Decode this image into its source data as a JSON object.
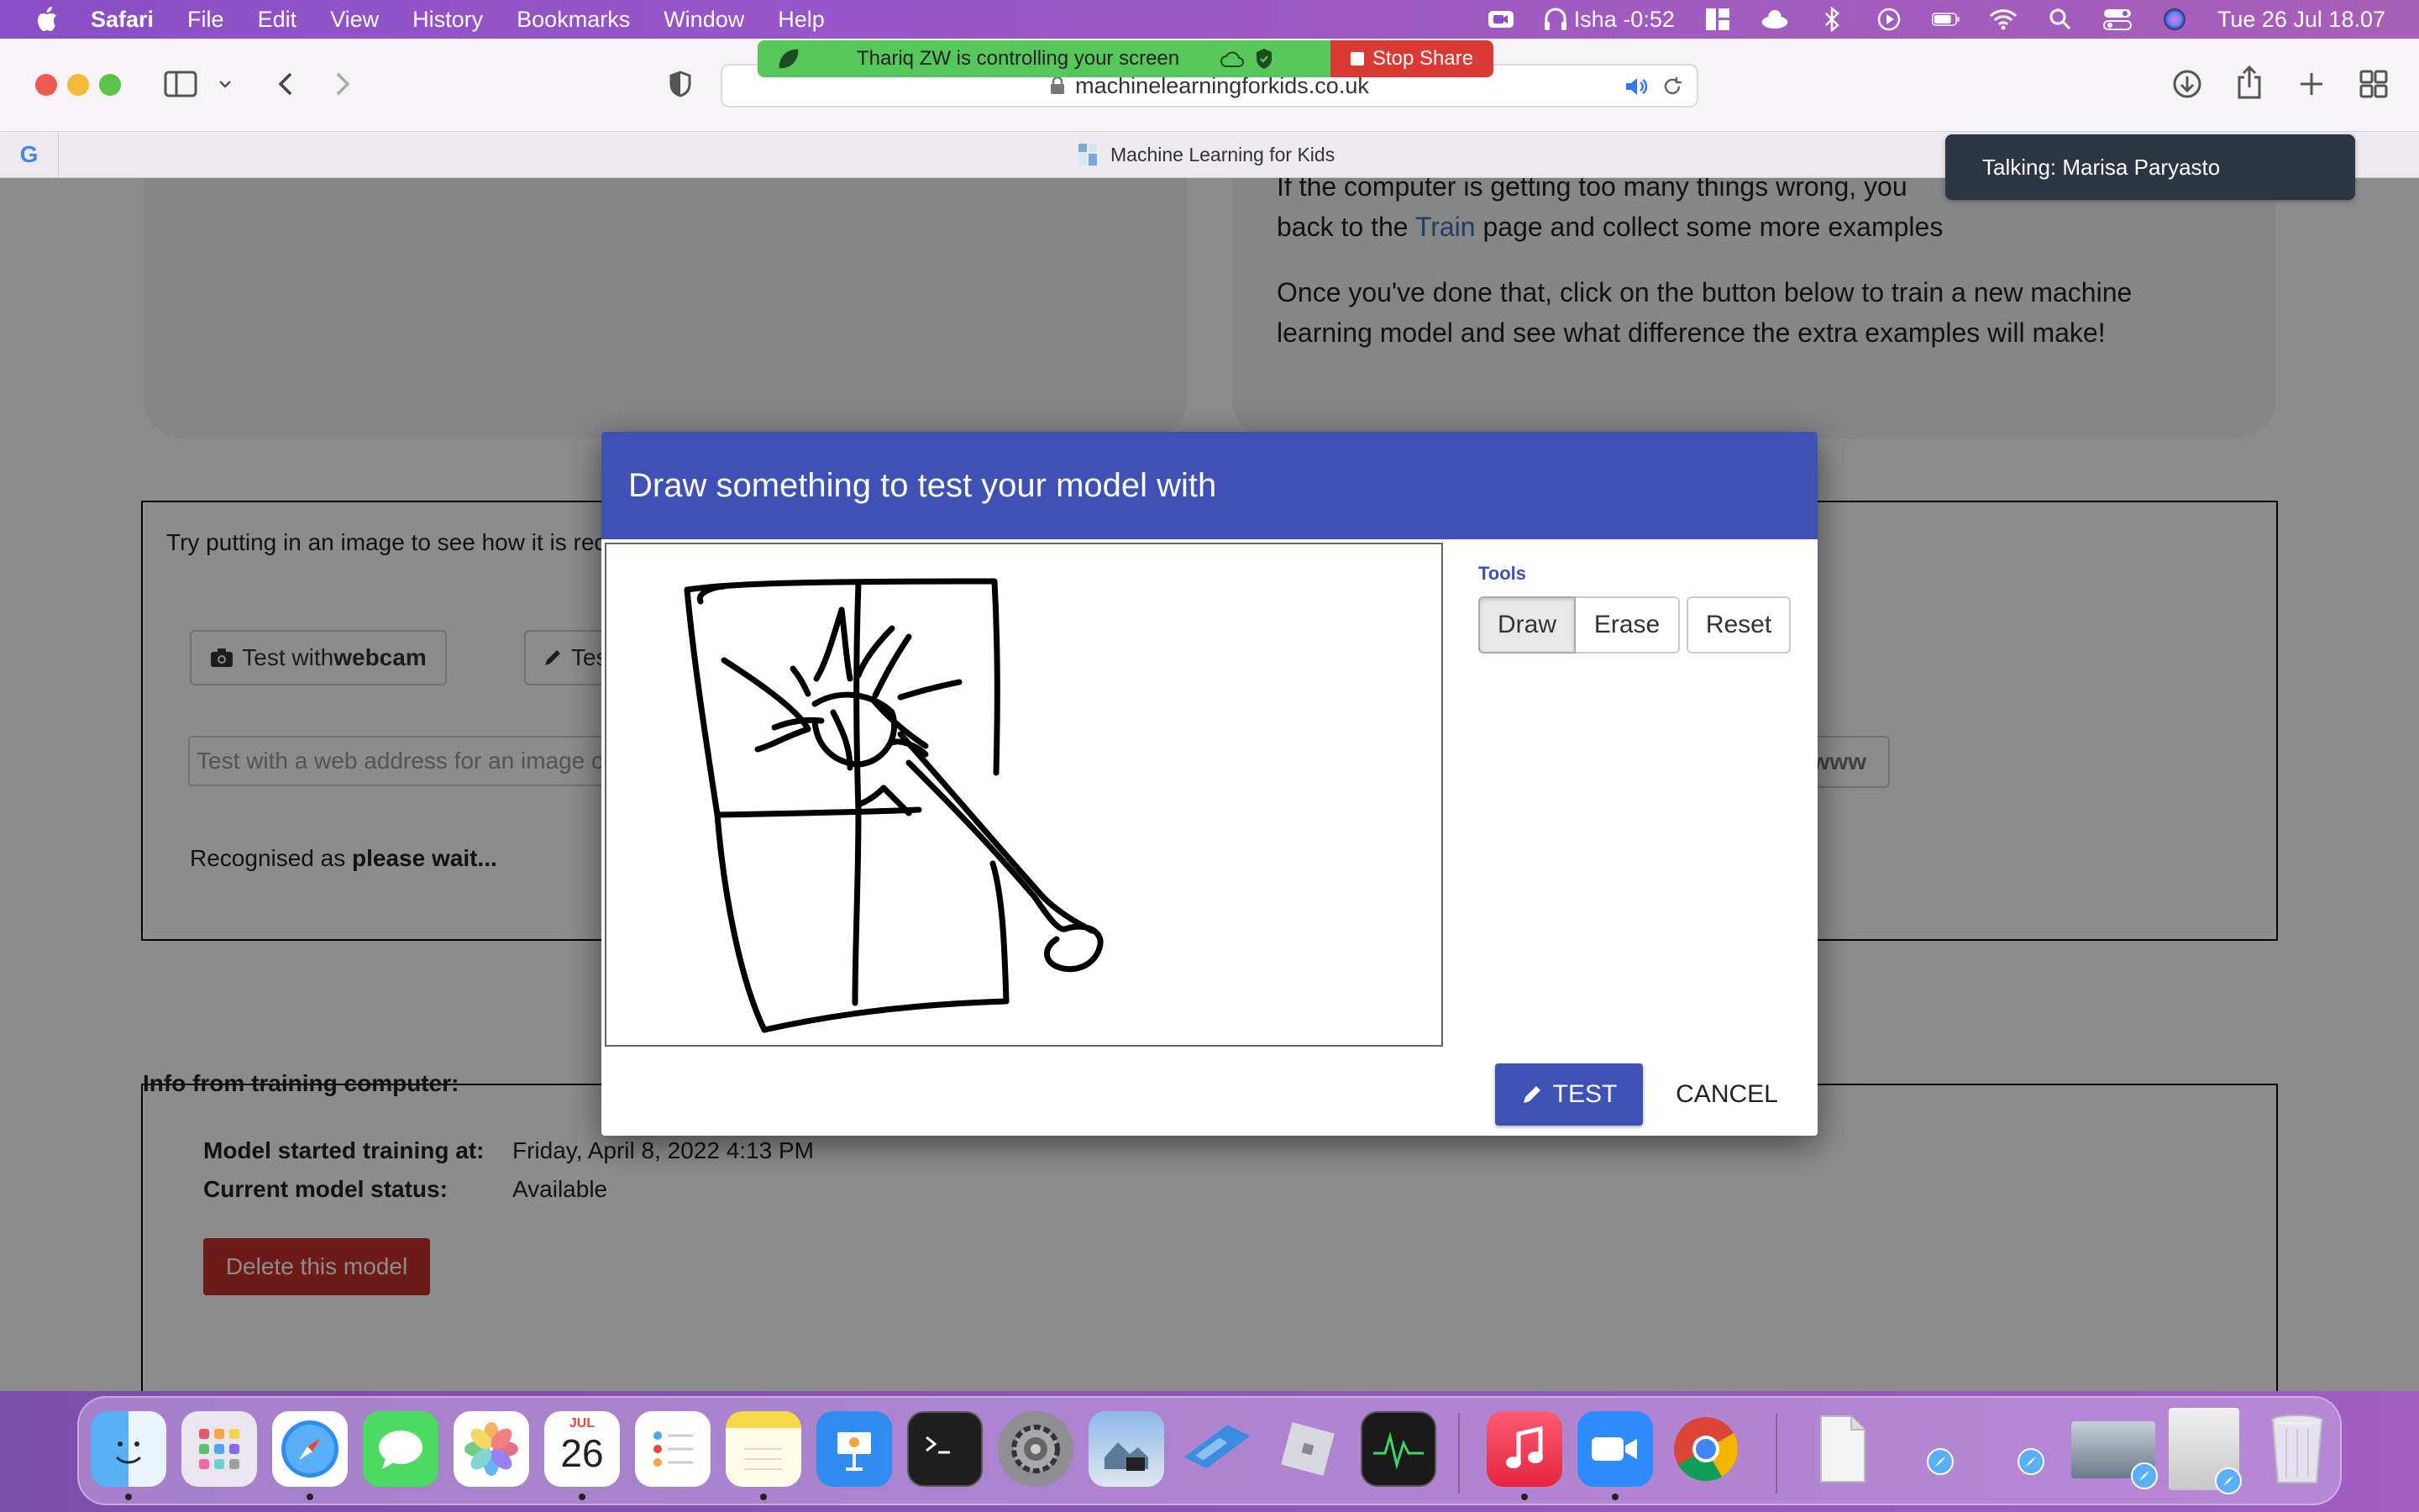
{
  "menubar": {
    "app": "Safari",
    "items": [
      "File",
      "Edit",
      "View",
      "History",
      "Bookmarks",
      "Window",
      "Help"
    ],
    "user_status": "Isha -0:52",
    "datetime": "Tue 26 Jul  18.07"
  },
  "share_banner": {
    "message": "Thariq ZW is controlling your screen",
    "stop_label": "Stop Share"
  },
  "talking": "Talking: Marisa Paryasto",
  "browser": {
    "url": "machinelearningforkids.co.uk",
    "tab_title": "Machine Learning for Kids"
  },
  "page": {
    "retrain_line1": "If the computer is getting too many things wrong, you",
    "retrain_line2_pre": "back to the ",
    "retrain_link": "Train",
    "retrain_line2_post": " page and collect some more examples",
    "retrain_para2_line1": "Once you've done that, click on the button below to train a new machine",
    "retrain_para2_line2": "learning model and see what difference the extra examples will make!",
    "test_intro": "Try putting in an image to see how it is rec",
    "webcam_button_pre": "Test with ",
    "webcam_button_bold": "webcam",
    "draw_button_partial": "Tes",
    "url_placeholder": "Test with a web address for an image o",
    "www_button": "www",
    "recognised_label": "Recognised as ",
    "recognised_value": "please wait...",
    "info_title": "Info from training computer:",
    "started_label": "Model started training at:",
    "started_value": "Friday, April 8, 2022 4:13 PM",
    "status_label": "Current model status:",
    "status_value": "Available",
    "delete_button": "Delete this model"
  },
  "dialog": {
    "title": "Draw something to test your model with",
    "tools_label": "Tools",
    "tools": [
      "Draw",
      "Erase",
      "Reset"
    ],
    "selected_tool": "Draw",
    "test_button": "TEST",
    "cancel_button": "CANCEL"
  },
  "dock": {
    "calendar_month": "JUL",
    "calendar_day": "26"
  },
  "colors": {
    "dialog_header": "#3f51b5",
    "delete_button": "#b94a48",
    "stop_share": "#d93a33",
    "share_green": "#57c65b"
  }
}
